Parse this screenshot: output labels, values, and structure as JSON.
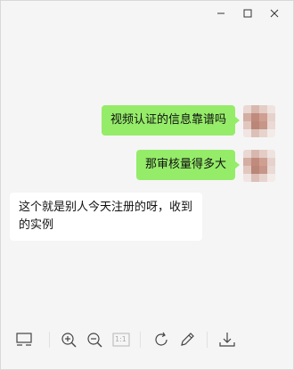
{
  "window": {
    "controls": [
      "minimize-icon",
      "maximize-icon",
      "close-icon"
    ]
  },
  "messages": [
    {
      "side": "right",
      "text": "视频认证的信息靠谱吗"
    },
    {
      "side": "right",
      "text": "那审核量得多大"
    },
    {
      "side": "left",
      "text": "这个就是别人今天注册的呀，收到的实例"
    }
  ],
  "toolbar": {
    "icons": [
      "thumbnail-icon",
      "zoom-in-icon",
      "zoom-out-icon",
      "actual-size-icon",
      "rotate-icon",
      "edit-icon",
      "download-icon"
    ],
    "actual_size_label": "1:1"
  },
  "colors": {
    "sent_bubble": "#95ec69",
    "received_bubble": "#ffffff",
    "background": "#f5f5f5"
  }
}
